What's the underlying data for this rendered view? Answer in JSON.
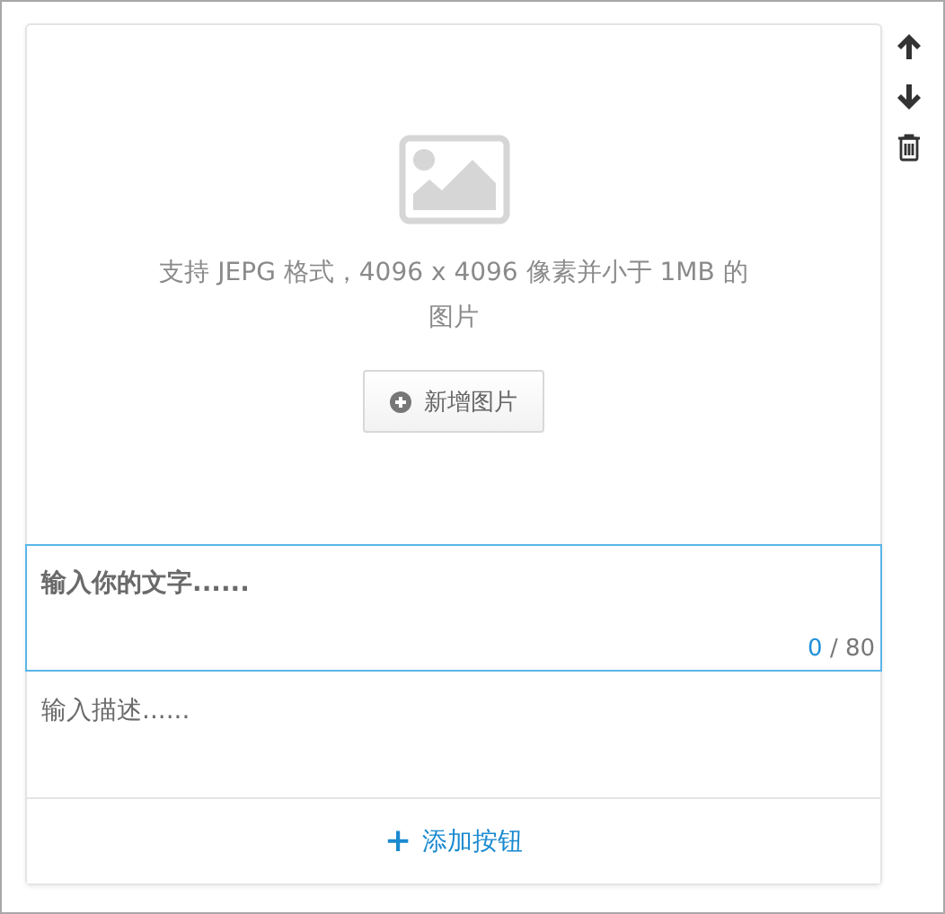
{
  "image_upload": {
    "hint": "支持 JEPG 格式，4096 x 4096 像素并小于 1MB 的图片",
    "button": "新增图片"
  },
  "title_field": {
    "placeholder": "输入你的文字......",
    "focused": true,
    "counter_current": "0",
    "counter_rest": "/ 80"
  },
  "description_field": {
    "placeholder": "输入描述......",
    "focused": false
  },
  "add_button": {
    "icon": "+",
    "label": "添加按钮"
  },
  "side_actions": [
    {
      "kind": "up"
    },
    {
      "kind": "down"
    },
    {
      "kind": "delete"
    }
  ]
}
